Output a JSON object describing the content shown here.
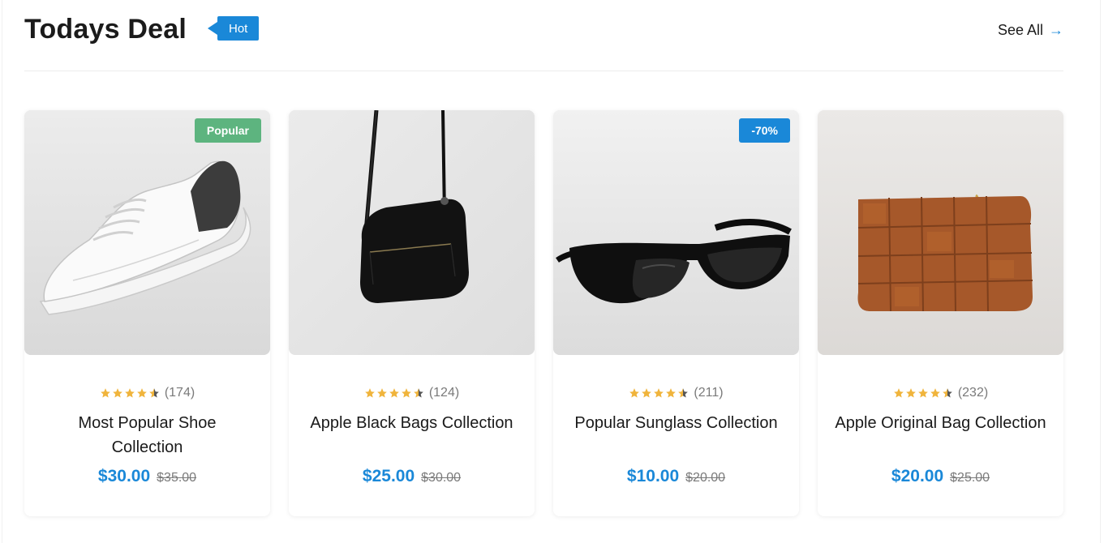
{
  "header": {
    "title": "Todays Deal",
    "badge": "Hot",
    "see_all_label": "See All",
    "see_all_icon": "arrow-right-icon",
    "accent_color": "#1a88d8"
  },
  "products": [
    {
      "name": "Most Popular Shoe Collection",
      "price": "$30.00",
      "old_price": "$35.00",
      "rating_stars": 4.5,
      "review_count": "(174)",
      "tag": "Popular",
      "tag_color": "#5db47f",
      "image": "white-sneaker"
    },
    {
      "name": "Apple Black Bags Collection",
      "price": "$25.00",
      "old_price": "$30.00",
      "rating_stars": 4.5,
      "review_count": "(124)",
      "tag": "",
      "image": "black-crossbody-bag"
    },
    {
      "name": "Popular Sunglass Collection",
      "price": "$10.00",
      "old_price": "$20.00",
      "rating_stars": 4.5,
      "review_count": "(211)",
      "tag": "-70%",
      "tag_color": "#1a88d8",
      "image": "black-sunglasses"
    },
    {
      "name": "Apple Original Bag Collection",
      "price": "$20.00",
      "old_price": "$25.00",
      "rating_stars": 4.5,
      "review_count": "(232)",
      "tag": "",
      "image": "brown-woven-tote-bag"
    }
  ],
  "colors": {
    "star": "#f0b43c",
    "star_empty": "#555555",
    "price": "#1a88d8"
  }
}
